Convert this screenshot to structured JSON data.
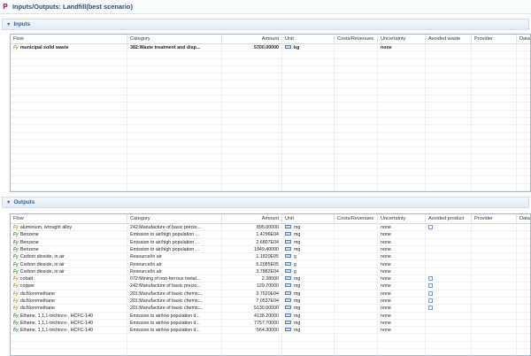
{
  "window": {
    "title": "Inputs/Outputs: Landfill(best scenario)"
  },
  "inputs": {
    "section_label": "Inputs",
    "columns": {
      "flow": "Flow",
      "category": "Category",
      "amount": "Amount",
      "unit": "Unit",
      "costs": "Costs/Revenues",
      "uncertainty": "Uncertainty",
      "avoided": "Avoided waste",
      "provider": "Provider",
      "data_quality": "Data qua"
    },
    "rows": [
      {
        "flow": "municipal solid waste",
        "category": "382:Waste treatment and disp...",
        "amount": "5700.00000",
        "unit": "kg",
        "uncertainty": "none",
        "flow_type": "product"
      }
    ]
  },
  "outputs": {
    "section_label": "Outputs",
    "columns": {
      "flow": "Flow",
      "category": "Category",
      "amount": "Amount",
      "unit": "Unit",
      "costs": "Costs/Revenues",
      "uncertainty": "Uncertainty",
      "avoided": "Avoided product",
      "provider": "Provider",
      "data_quality": "Data qua"
    },
    "rows": [
      {
        "flow": "aluminium, wrought alloy",
        "category": "242:Manufacture of basic precio...",
        "amount": "895.00000",
        "unit": "mg",
        "uncertainty": "none",
        "flow_type": "product",
        "avoided_box": true
      },
      {
        "flow": "Benzene",
        "category": "Emission to air/high population ...",
        "amount": "1.4296E04",
        "unit": "mg",
        "uncertainty": "none",
        "flow_type": "elem",
        "avoided_box": false
      },
      {
        "flow": "Benzene",
        "category": "Emission to air/high population ...",
        "amount": "2.6807E04",
        "unit": "mg",
        "uncertainty": "none",
        "flow_type": "elem",
        "avoided_box": false
      },
      {
        "flow": "Benzene",
        "category": "Emission to air/high population ...",
        "amount": "1949.40000",
        "unit": "mg",
        "uncertainty": "none",
        "flow_type": "elem",
        "avoided_box": false
      },
      {
        "flow": "Carbon dioxide, in air",
        "category": "Resource/in air",
        "amount": "1.1820E05",
        "unit": "g",
        "uncertainty": "none",
        "flow_type": "elem",
        "avoided_box": false
      },
      {
        "flow": "Carbon dioxide, in air",
        "category": "Resource/in air",
        "amount": "5.2085E05",
        "unit": "g",
        "uncertainty": "none",
        "flow_type": "elem",
        "avoided_box": false
      },
      {
        "flow": "Carbon dioxide, in air",
        "category": "Resource/in air",
        "amount": "3.7882E04",
        "unit": "g",
        "uncertainty": "none",
        "flow_type": "elem",
        "avoided_box": false
      },
      {
        "flow": "cobalt",
        "category": "072:Mining of non-ferrous metal...",
        "amount": "2.38000",
        "unit": "mg",
        "uncertainty": "none",
        "flow_type": "product",
        "avoided_box": true
      },
      {
        "flow": "copper",
        "category": "242:Manufacture of basic precio...",
        "amount": "129.70000",
        "unit": "mg",
        "uncertainty": "none",
        "flow_type": "product",
        "avoided_box": true
      },
      {
        "flow": "dichloromethane",
        "category": "201:Manufacture of basic chemic...",
        "amount": "3.7620E04",
        "unit": "mg",
        "uncertainty": "none",
        "flow_type": "product",
        "avoided_box": true
      },
      {
        "flow": "dichloromethane",
        "category": "201:Manufacture of basic chemic...",
        "amount": "7.0537E04",
        "unit": "mg",
        "uncertainty": "none",
        "flow_type": "product",
        "avoided_box": true
      },
      {
        "flow": "dichloromethane",
        "category": "201:Manufacture of basic chemic...",
        "amount": "5130.00000",
        "unit": "mg",
        "uncertainty": "none",
        "flow_type": "product",
        "avoided_box": true
      },
      {
        "flow": "Ethane, 1,1,1-trichloro-, HCFC-140",
        "category": "Emission to air/low population d...",
        "amount": "4138.20000",
        "unit": "mg",
        "uncertainty": "none",
        "flow_type": "elem",
        "avoided_box": false
      },
      {
        "flow": "Ethane, 1,1,1-trichloro-, HCFC-140",
        "category": "Emission to air/low population d...",
        "amount": "7757.70000",
        "unit": "mg",
        "uncertainty": "none",
        "flow_type": "elem",
        "avoided_box": false
      },
      {
        "flow": "Ethane, 1,1,1-trichloro-, HCFC-140",
        "category": "Emission to air/low population d...",
        "amount": "564.30000",
        "unit": "mg",
        "uncertainty": "none",
        "flow_type": "elem",
        "avoided_box": false
      }
    ]
  }
}
